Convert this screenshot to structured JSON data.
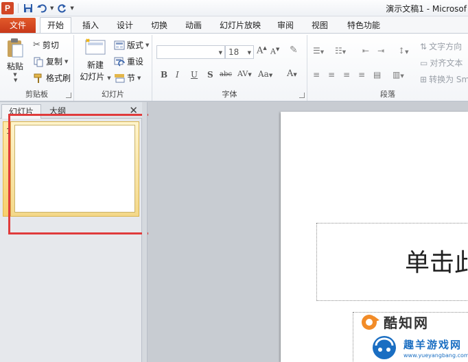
{
  "window": {
    "title": "演示文稿1 - Microsof"
  },
  "tabs": {
    "file": "文件",
    "home": "开始",
    "insert": "插入",
    "design": "设计",
    "transitions": "切换",
    "animations": "动画",
    "slideshow": "幻灯片放映",
    "review": "审阅",
    "view": "视图",
    "special": "特色功能"
  },
  "clipboard": {
    "paste": "粘贴",
    "cut": "剪切",
    "copy": "复制",
    "format_painter": "格式刷",
    "label": "剪贴板"
  },
  "slides_group": {
    "new_slide_line1": "新建",
    "new_slide_line2": "幻灯片",
    "layout": "版式",
    "reset": "重设",
    "section": "节",
    "label": "幻灯片"
  },
  "font": {
    "size": "18",
    "label": "字体",
    "bold": "B",
    "italic": "I",
    "underline": "U",
    "shadow": "S",
    "strike": "abc"
  },
  "paragraph": {
    "text_direction": "文字方向",
    "align_text": "对齐文本",
    "convert_to": "转换为 Sm",
    "label": "段落"
  },
  "pane": {
    "tab_slides": "幻灯片",
    "tab_outline": "大纲",
    "slide_number": "1"
  },
  "slide": {
    "title_placeholder": "单击此"
  },
  "watermarks": {
    "site1": "酷知网",
    "site2_cn": "趣羊游戏网",
    "site2_url": "www.yueyangbang.com"
  },
  "colors": {
    "file_tab": "#d24726",
    "highlight": "#e03b3b",
    "selected_thumb": "#f4d889"
  }
}
